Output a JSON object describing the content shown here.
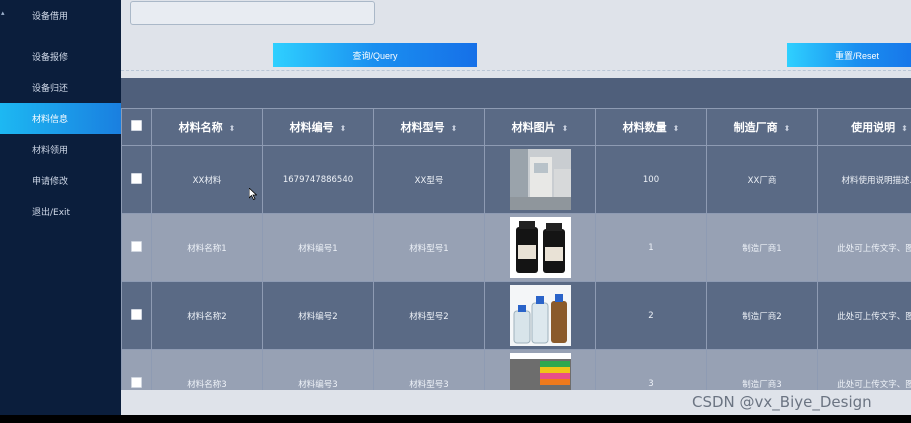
{
  "sidebar": {
    "items": [
      {
        "label": "设备借用",
        "active": false
      },
      {
        "label": "设备报修",
        "active": false
      },
      {
        "label": "设备归还",
        "active": false
      },
      {
        "label": "材料信息",
        "active": true
      },
      {
        "label": "材料领用",
        "active": false
      },
      {
        "label": "申请修改",
        "active": false
      },
      {
        "label": "退出/Exit",
        "active": false
      }
    ]
  },
  "toolbar": {
    "search_value": "",
    "search_placeholder": "",
    "query_label": "查询/Query",
    "reset_label": "重置/Reset"
  },
  "table": {
    "columns": [
      "材料名称",
      "材料编号",
      "材料型号",
      "材料图片",
      "材料数量",
      "制造厂商",
      "使用说明"
    ],
    "rows": [
      {
        "name": "XX材料",
        "code": "1679747886540",
        "model": "XX型号",
        "image": "lab-equipment-photo",
        "qty": "100",
        "maker": "XX厂商",
        "desc": "材料使用说明描述..."
      },
      {
        "name": "材料名称1",
        "code": "材料编号1",
        "model": "材料型号1",
        "image": "reagent-bottles-photo",
        "qty": "1",
        "maker": "制造厂商1",
        "desc": "此处可上传文字、图..."
      },
      {
        "name": "材料名称2",
        "code": "材料编号2",
        "model": "材料型号2",
        "image": "glass-bottles-photo",
        "qty": "2",
        "maker": "制造厂商2",
        "desc": "此处可上传文字、图..."
      },
      {
        "name": "材料名称3",
        "code": "材料编号3",
        "model": "材料型号3",
        "image": "colored-tips-photo",
        "qty": "3",
        "maker": "制造厂商3",
        "desc": "此处可上传文字、图..."
      }
    ]
  },
  "watermark": "CSDN @vx_Biye_Design",
  "colors": {
    "sidebar_bg": "#0b1e3c",
    "active_accent": "#1a8ff0",
    "table_header": "#5a6a85",
    "row_light": "#97a1b4"
  }
}
